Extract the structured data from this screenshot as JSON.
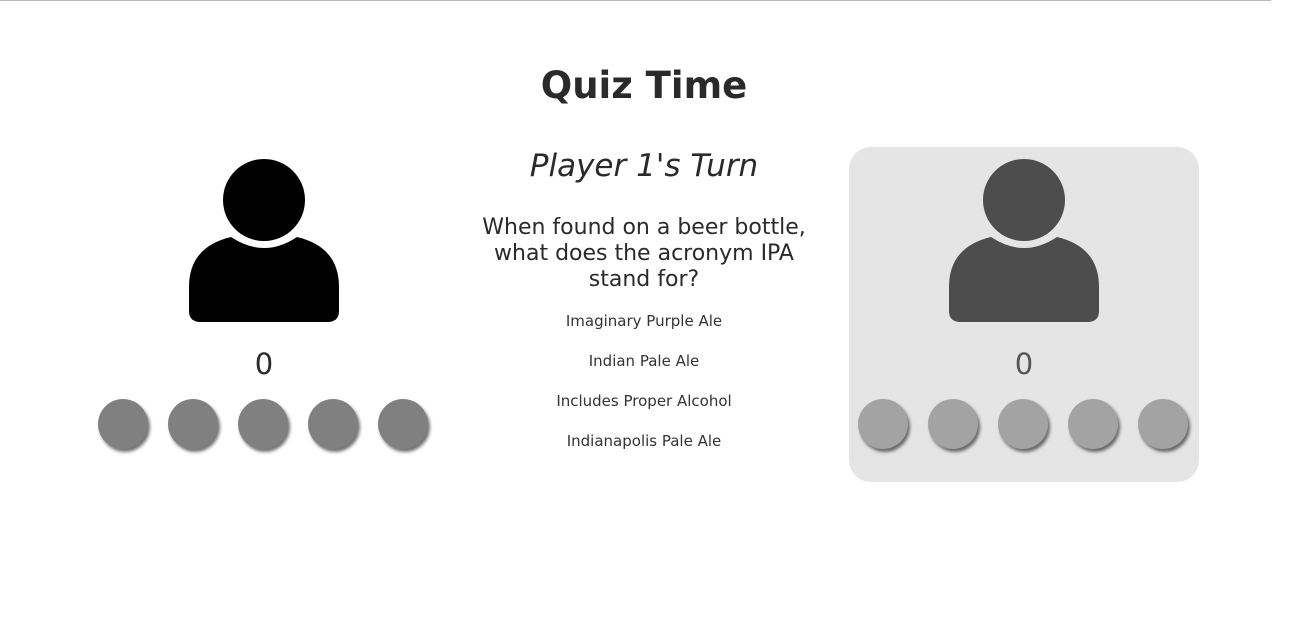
{
  "title": "Quiz Time",
  "turn_label": "Player 1's Turn",
  "question": "When found on a beer bottle, what does the acronym IPA stand for?",
  "answers": [
    "Imaginary Purple Ale",
    "Indian Pale Ale",
    "Includes Proper Alcohol",
    "Indianapolis Pale Ale"
  ],
  "players": [
    {
      "score": "0",
      "avatar_icon": "user-icon",
      "active": true,
      "avatar_color": "#000000",
      "life_count": 5
    },
    {
      "score": "0",
      "avatar_icon": "user-icon",
      "active": false,
      "avatar_color": "#4d4d4d",
      "life_count": 5
    }
  ],
  "colors": {
    "inactive_panel_bg": "#e6e5e6",
    "active_life": "#808080",
    "inactive_life": "#a3a3a3"
  }
}
